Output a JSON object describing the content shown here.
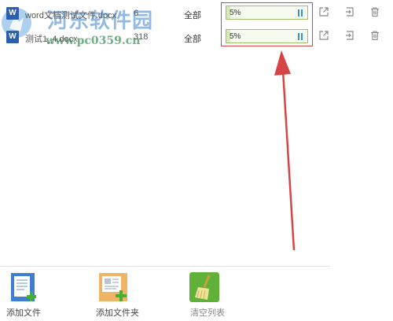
{
  "watermark": {
    "title": "河东软件园",
    "url": "www.pc0359.cn"
  },
  "files": [
    {
      "name": "word文档测试文件.docx",
      "size": "6",
      "pages": "全部",
      "progress_text": "5%",
      "progress": 0.05
    },
    {
      "name": "测试1_4.docx",
      "size": "318",
      "pages": "全部",
      "progress_text": "5%",
      "progress": 0.05
    }
  ],
  "file_icon_letter": "W",
  "toolbar": {
    "add_file_label": "添加文件",
    "add_folder_label": "添加文件夹",
    "clear_list_label": "清空列表"
  },
  "colors": {
    "accent": "#3b8fd9",
    "progress_border": "#9bbf6a",
    "highlight": "#d04848",
    "arrow": "#d64545"
  },
  "icons": {
    "row_actions": [
      "open-external-icon",
      "export-icon",
      "trash-icon"
    ],
    "progress_control": "pause-icon"
  }
}
